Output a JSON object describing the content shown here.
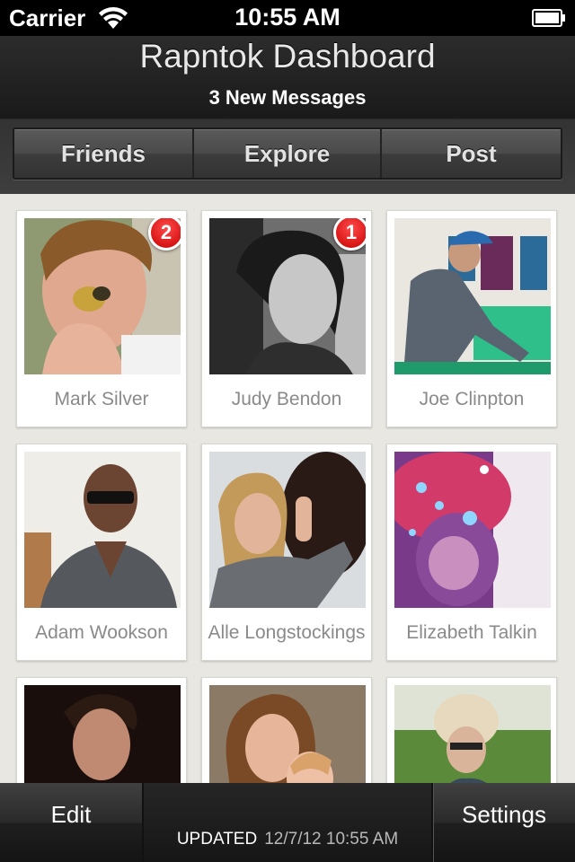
{
  "status_bar": {
    "carrier": "Carrier",
    "time": "10:55 AM"
  },
  "header": {
    "title": "Rapntok Dashboard",
    "subtitle": "3 New Messages"
  },
  "segments": [
    "Friends",
    "Explore",
    "Post"
  ],
  "contacts": [
    {
      "name": "Mark Silver",
      "badge": "2"
    },
    {
      "name": "Judy Bendon",
      "badge": "1"
    },
    {
      "name": "Joe Clinpton"
    },
    {
      "name": "Adam Wookson"
    },
    {
      "name": "Alle Longstockings"
    },
    {
      "name": "Elizabeth Talkin"
    },
    {
      "name": ""
    },
    {
      "name": ""
    },
    {
      "name": ""
    }
  ],
  "toolbar": {
    "edit_label": "Edit",
    "settings_label": "Settings",
    "updated_label": "UPDATED",
    "updated_value": "12/7/12  10:55 AM"
  },
  "colors": {
    "badge": "#d40000",
    "header_bg": "#1e1e1e",
    "page_bg": "#e8e7e2"
  }
}
